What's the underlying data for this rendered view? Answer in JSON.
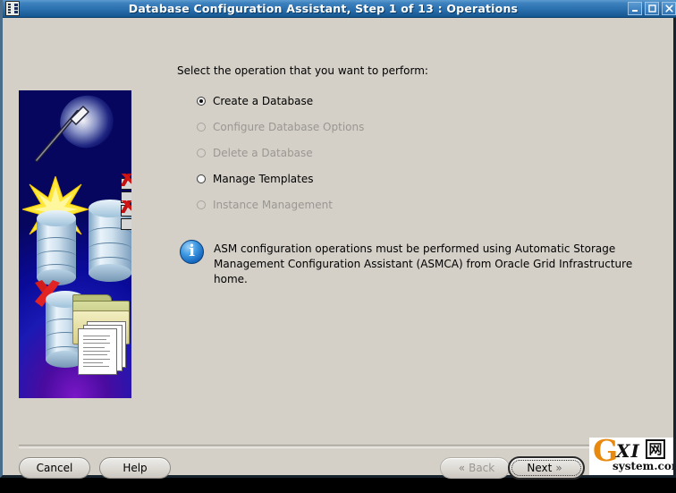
{
  "window": {
    "title": "Database Configuration Assistant, Step 1 of 13 : Operations",
    "icon": "app-icon",
    "minimize_label": "_",
    "maximize_label": "□",
    "close_label": "×"
  },
  "main": {
    "prompt": "Select the operation that you want to perform:",
    "options": [
      {
        "label": "Create a Database",
        "selected": true,
        "enabled": true
      },
      {
        "label": "Configure Database Options",
        "selected": false,
        "enabled": false
      },
      {
        "label": "Delete a Database",
        "selected": false,
        "enabled": false
      },
      {
        "label": "Manage Templates",
        "selected": false,
        "enabled": true
      },
      {
        "label": "Instance Management",
        "selected": false,
        "enabled": false
      }
    ],
    "note": {
      "icon": "info-icon",
      "line1": "ASM configuration operations must be performed using Automatic Storage",
      "line2": "Management Configuration Assistant (ASMCA) from Oracle Grid Infrastructure home."
    }
  },
  "artwork": {
    "name": "database-wizard-illustration",
    "alt": "Magic wand with star over database cylinders, checklist, red X and document folder"
  },
  "footer": {
    "cancel": "Cancel",
    "help": "Help",
    "back": "Back",
    "next": "Next",
    "back_chevron": "«",
    "next_chevron": "»",
    "back_enabled": false,
    "next_enabled": true
  },
  "watermark": {
    "g": "G",
    "xi": "XI",
    "cn": "网",
    "domain": "system.com"
  },
  "colors": {
    "titlebar_top": "#5d9bd0",
    "titlebar_bottom": "#14568f",
    "window_face": "#d4d0c8",
    "art_blue": "#1414c4",
    "art_purple": "#5a12bd",
    "info_blue": "#1769c0",
    "accent_orange": "#e8890d",
    "check_red": "#d01515"
  }
}
